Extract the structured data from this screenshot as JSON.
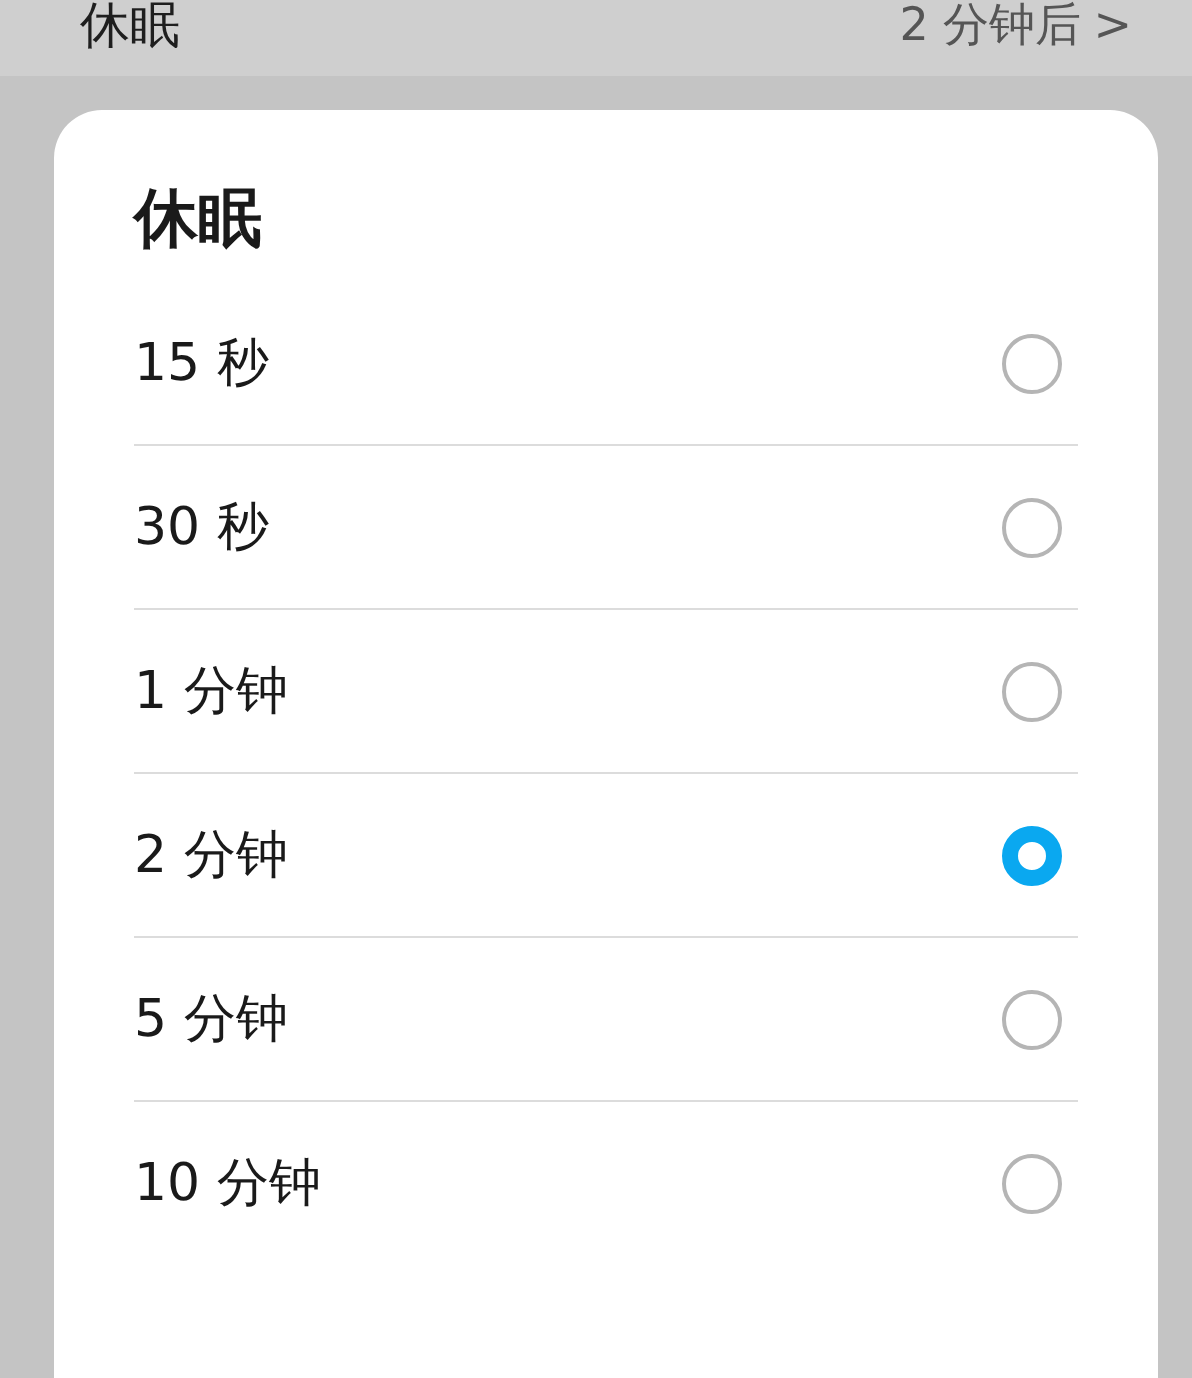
{
  "background_row": {
    "label": "休眠",
    "value": "2 分钟后",
    "chevron": ">"
  },
  "dialog": {
    "title": "休眠",
    "options": [
      {
        "label": "15 秒",
        "selected": false
      },
      {
        "label": "30 秒",
        "selected": false
      },
      {
        "label": "1 分钟",
        "selected": false
      },
      {
        "label": "2 分钟",
        "selected": true
      },
      {
        "label": "5 分钟",
        "selected": false
      },
      {
        "label": "10 分钟",
        "selected": false
      }
    ]
  }
}
